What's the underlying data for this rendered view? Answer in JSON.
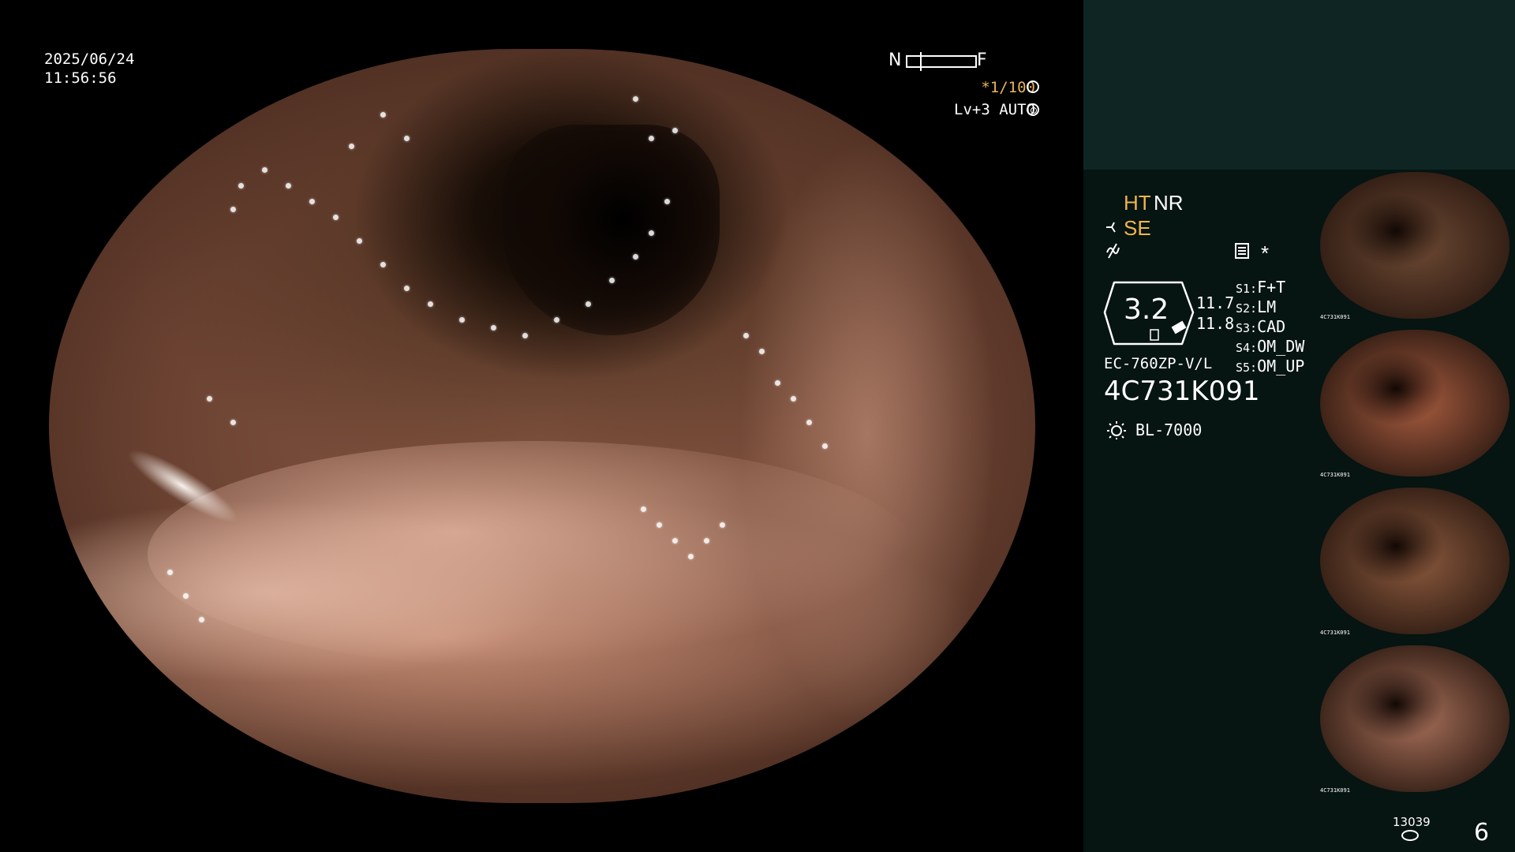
{
  "overlay": {
    "date": "2025/06/24",
    "time": "11:56:56",
    "nf_near": "N",
    "nf_far": "F",
    "shutter": "*1/100",
    "level": "Lv+3 AUTO",
    "shutter_icon": "aperture-icon",
    "level_icon": "iris-auto-icon"
  },
  "panel": {
    "ht": "HT",
    "nr": "NR",
    "se": "SE",
    "star": "*",
    "gauge_value": "3.2",
    "gauge_right_top": "11.7",
    "gauge_right_bottom": "11.8",
    "settings": [
      {
        "key": "S1:",
        "value": "F+T"
      },
      {
        "key": "S2:",
        "value": "LM"
      },
      {
        "key": "S3:",
        "value": "CAD"
      },
      {
        "key": "S4:",
        "value": "OM_DW"
      },
      {
        "key": "S5:",
        "value": "OM_UP"
      }
    ],
    "scope_model": "EC-760ZP-V/L",
    "serial": "4C731K091",
    "light_source": "BL-7000",
    "counter_small": "13039",
    "page_number": "6"
  },
  "thumbnails": [
    {
      "label": "4C731K091",
      "tone": "#6e4a34"
    },
    {
      "label": "4C731K091",
      "tone": "#a85c40"
    },
    {
      "label": "4C731K091",
      "tone": "#8c5a3e"
    },
    {
      "label": "4C731K091",
      "tone": "#a8705a"
    }
  ],
  "colors": {
    "accent_amber": "#f0b64a",
    "panel_top": "#0e2523",
    "panel_bottom": "#061412"
  }
}
